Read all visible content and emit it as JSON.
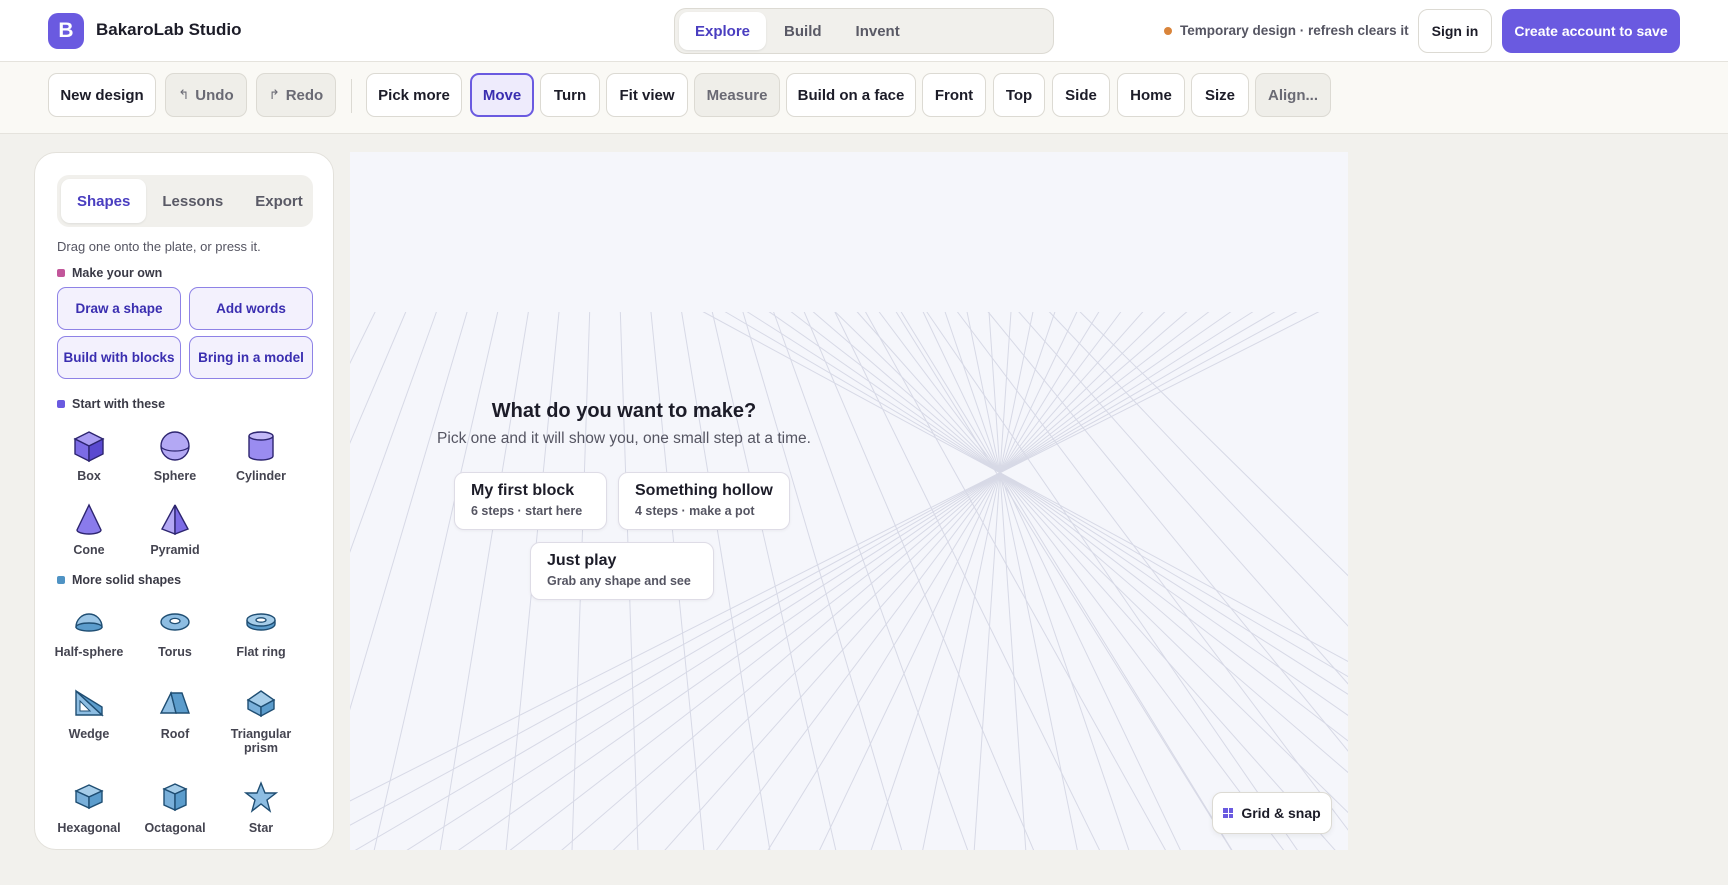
{
  "header": {
    "logo_letter": "B",
    "app_title": "BakaroLab Studio",
    "mode_tabs": [
      {
        "label": "Explore",
        "active": true
      },
      {
        "label": "Build",
        "active": false
      },
      {
        "label": "Invent",
        "active": false
      }
    ],
    "temp_note": "Temporary design · refresh clears it",
    "sign_in": "Sign in",
    "create_account": "Create account to save"
  },
  "toolbar": {
    "new_design": "New design",
    "undo": "Undo",
    "redo": "Redo",
    "pick_more": "Pick more",
    "move": "Move",
    "turn": "Turn",
    "fit_view": "Fit view",
    "measure": "Measure",
    "build_on_face": "Build on a face",
    "front": "Front",
    "top": "Top",
    "side": "Side",
    "home": "Home",
    "size": "Size",
    "align": "Align..."
  },
  "left_panel": {
    "tabs": [
      {
        "label": "Shapes",
        "active": true
      },
      {
        "label": "Lessons",
        "active": false
      },
      {
        "label": "Export",
        "active": false
      }
    ],
    "hint": "Drag one onto the plate, or press it.",
    "make_your_own": {
      "label": "Make your own",
      "buttons": [
        "Draw a shape",
        "Add words",
        "Build with blocks",
        "Bring in a model"
      ]
    },
    "start_with": {
      "label": "Start with these",
      "shapes": [
        "Box",
        "Sphere",
        "Cylinder",
        "Cone",
        "Pyramid"
      ]
    },
    "more_solid": {
      "label": "More solid shapes",
      "shapes": [
        "Half-sphere",
        "Torus",
        "Flat ring",
        "Wedge",
        "Roof",
        "Triangular prism",
        "Hexagonal",
        "Octagonal",
        "Star"
      ]
    }
  },
  "canvas": {
    "prompt_title": "What do you want to make?",
    "prompt_sub": "Pick one and it will show you, one small step at a time.",
    "choices": [
      {
        "title": "My first block",
        "sub": "6 steps · start here"
      },
      {
        "title": "Something hollow",
        "sub": "4 steps · make a pot"
      },
      {
        "title": "Just play",
        "sub": "Grab any shape and see"
      }
    ],
    "grid_snap": "Grid & snap"
  },
  "colors": {
    "accent": "#6a5ae0",
    "accent_dark": "#3a2eb0",
    "temp_dot": "#d9843a",
    "section_pink": "#c2569a",
    "section_purple": "#6a5ae0",
    "section_blue": "#4f93c4"
  }
}
